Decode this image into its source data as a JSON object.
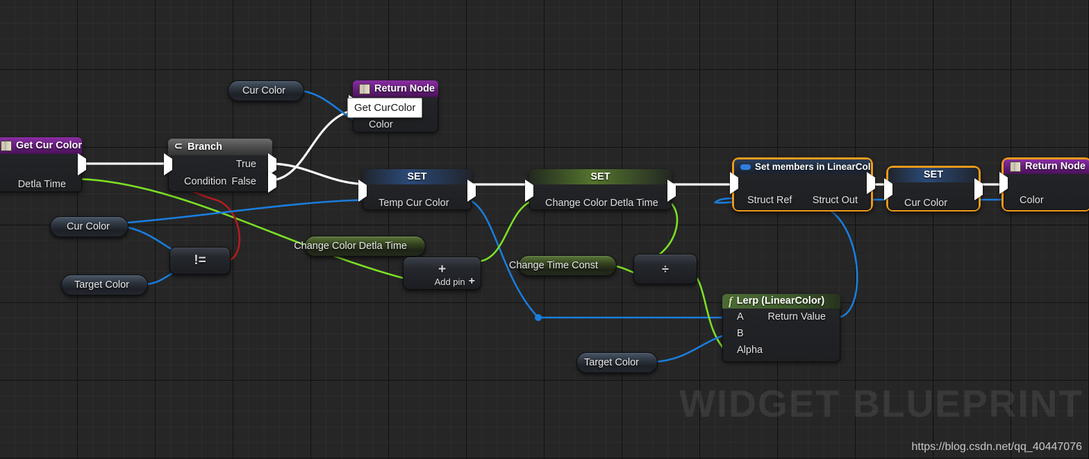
{
  "canvas": {
    "watermark": "WIDGET BLUEPRINT",
    "url": "https://blog.csdn.net/qq_40447076"
  },
  "tooltip": {
    "text": "Get CurColor"
  },
  "nodes": {
    "get_cur_color": {
      "title": "Get Cur Color",
      "icon": "book-icon",
      "outputs": [
        {
          "label": "Detla Time",
          "pin": "green"
        }
      ]
    },
    "branch": {
      "title": "Branch",
      "icon": "branch-icon",
      "inputs": [
        {
          "label": "Condition",
          "pin": "red"
        }
      ],
      "outputs": [
        {
          "label": "True",
          "pin": "exec"
        },
        {
          "label": "False",
          "pin": "exec"
        }
      ]
    },
    "return_node_top": {
      "title": "Return Node",
      "icon": "book-icon",
      "inputs": [
        {
          "label": "Color",
          "pin": "blue"
        }
      ]
    },
    "return_node_right": {
      "title": "Return Node",
      "icon": "book-icon",
      "selected": true,
      "inputs": [
        {
          "label": "Color",
          "pin": "blue"
        }
      ]
    },
    "set_temp_cur_color": {
      "title": "SET",
      "inputs": [
        {
          "label": "Temp Cur Color",
          "pin": "blue"
        }
      ]
    },
    "set_change_color_detla_time": {
      "title": "SET",
      "inputs": [
        {
          "label": "Change Color Detla Time",
          "pin": "green"
        }
      ]
    },
    "set_members_linearcolor": {
      "title": "Set members in LinearColor",
      "icon": "struct-icon",
      "selected": true,
      "inputs": [
        {
          "label": "Struct Ref",
          "pin": "diamond"
        }
      ],
      "outputs": [
        {
          "label": "Struct Out",
          "pin": "diamond"
        }
      ]
    },
    "set_cur_color": {
      "title": "SET",
      "selected": true,
      "inputs": [
        {
          "label": "Cur Color",
          "pin": "blue"
        }
      ]
    },
    "lerp_linearcolor": {
      "title": "Lerp (LinearColor)",
      "icon": "function-icon",
      "inputs": [
        {
          "label": "A",
          "pin": "blue"
        },
        {
          "label": "B",
          "pin": "blue"
        },
        {
          "label": "Alpha",
          "pin": "green"
        }
      ],
      "outputs": [
        {
          "label": "Return Value",
          "pin": "blue"
        }
      ]
    }
  },
  "variables": {
    "cur_color_top": {
      "label": "Cur Color",
      "pin": "blue"
    },
    "cur_color_left": {
      "label": "Cur Color",
      "pin": "blue"
    },
    "target_color_left": {
      "label": "Target Color",
      "pin": "blue"
    },
    "change_color_detla_time": {
      "label": "Change Color Detla Time",
      "pin": "green"
    },
    "change_time_const": {
      "label": "Change Time Const",
      "pin": "green"
    },
    "target_color_bottom": {
      "label": "Target Color",
      "pin": "blue"
    }
  },
  "math_nodes": {
    "not_equal": {
      "symbol": "!=",
      "inputs": 2,
      "output_pin": "red"
    },
    "add": {
      "symbol": "+",
      "add_pin_label": "Add pin",
      "add_pin_glyph": "+"
    },
    "divide": {
      "symbol": "÷"
    }
  },
  "colors": {
    "selection": "#f09a1b",
    "exec_wire": "#ffffff",
    "struct_wire": "#1a7ddd",
    "float_wire": "#7ce025",
    "bool_wire": "#c71b1b",
    "purple_header": "#6a1f80",
    "background": "#262626"
  }
}
